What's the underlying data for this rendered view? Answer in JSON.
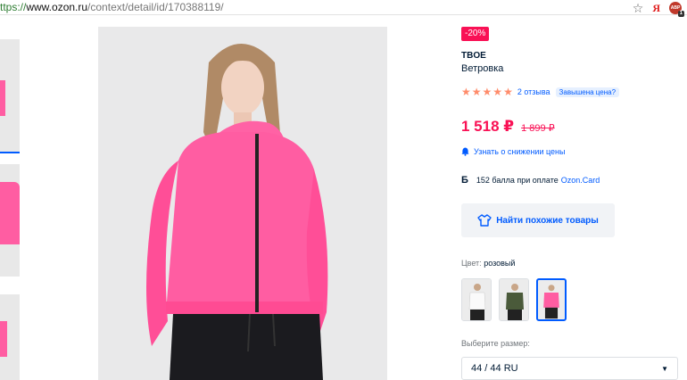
{
  "browser": {
    "url_scheme": "ttps://",
    "url_domain": "www.ozon.ru",
    "url_path": "/context/detail/id/170388119/",
    "extensions": {
      "yandex": "Я",
      "adblock": "ABP",
      "adblock_count": "1"
    },
    "icons": [
      "bookmark-star-icon",
      "yandex-icon",
      "adblock-icon"
    ]
  },
  "product": {
    "discount": "-20%",
    "brand": "TBOE",
    "type": "Ветровка",
    "rating": {
      "stars": 5,
      "reviews": "2 отзыва",
      "price_complaint": "Завышена цена?"
    },
    "price": "1 518 ₽",
    "old_price": "1 899 ₽",
    "notify": "Узнать о снижении цены",
    "points": {
      "text": "152 балла при оплате",
      "card": "Ozon.Card"
    },
    "similar_button": "Найти похожие товары",
    "color": {
      "label": "Цвет:",
      "value": "розовый"
    },
    "swatch_colors": [
      "#f4f4f4",
      "#4a5a3a",
      "#ff5da2"
    ],
    "size": {
      "label": "Выберите размер:",
      "value": "44 / 44 RU"
    }
  },
  "colors": {
    "accent": "#005bff",
    "price": "#f91155",
    "jacket": "#ff5da2"
  }
}
